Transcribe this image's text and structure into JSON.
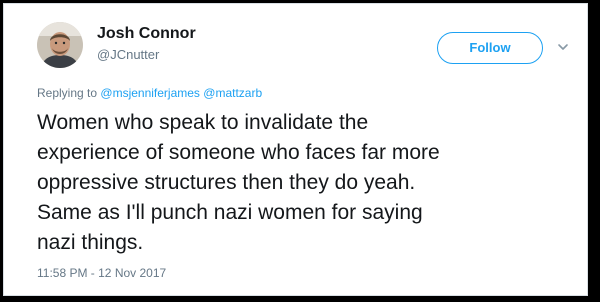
{
  "author": {
    "display_name": "Josh Connor",
    "handle": "@JCnutter",
    "avatar_icon": "user-avatar-photo"
  },
  "follow_button": {
    "label": "Follow"
  },
  "caret_icon": "chevron-down-icon",
  "reply": {
    "prefix": "Replying to",
    "mentions": [
      "@msjenniferjames",
      "@mattzarb"
    ]
  },
  "tweet": {
    "lines": [
      "Women who speak to invalidate the",
      "experience of someone who faces far more",
      "oppressive structures then they do yeah.",
      "Same as I'll punch nazi women for saying",
      "nazi things."
    ]
  },
  "timestamp": "11:58 PM - 12 Nov 2017",
  "colors": {
    "accent": "#1da1f2",
    "text_primary": "#14171a",
    "text_secondary": "#657786",
    "background": "#ffffff",
    "border": "#d9dfe4"
  }
}
